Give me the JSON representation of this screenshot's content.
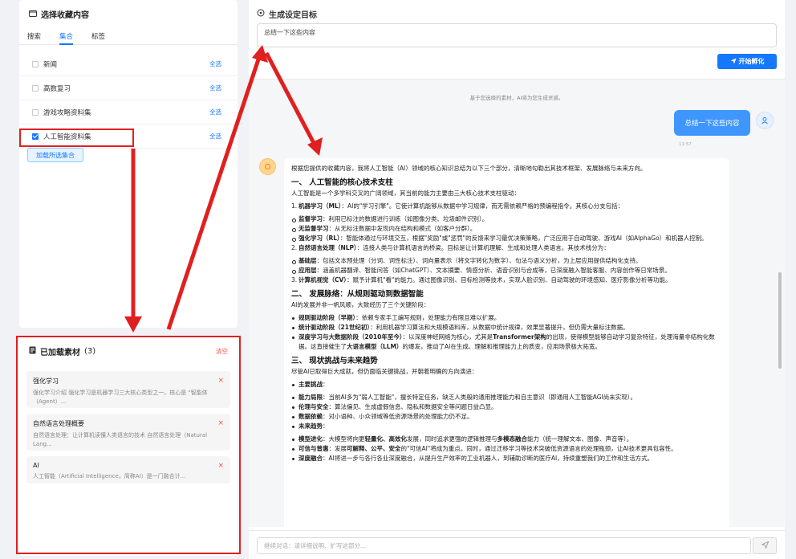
{
  "left_panel": {
    "title": "选择收藏内容",
    "tabs": [
      {
        "label": "搜索",
        "active": false
      },
      {
        "label": "集合",
        "active": true
      },
      {
        "label": "标签",
        "active": false
      }
    ],
    "collections": [
      {
        "label": "新闻",
        "checked": false,
        "select_all": "全选"
      },
      {
        "label": "高数复习",
        "checked": false,
        "select_all": "全选"
      },
      {
        "label": "游戏攻略资料集",
        "checked": false,
        "select_all": "全选"
      },
      {
        "label": "人工智能资料集",
        "checked": true,
        "select_all": "全选"
      }
    ],
    "load_button": "加载所选集合"
  },
  "loaded_panel": {
    "title": "已加载素材",
    "count": "(3)",
    "clear_label": "清空",
    "items": [
      {
        "title": "强化学习",
        "desc": "强化学习介绍 强化学习是机器学习三大核心类型之一。核心是 \"智能体（Agent）...",
        "remove": "×"
      },
      {
        "title": "自然语言处理概要",
        "desc": "自然语言处理：让计算机读懂人类语言的技术 自然语言处理（Natural Lang...",
        "remove": "×"
      },
      {
        "title": "AI",
        "desc": "人工智能（Artificial Intelligence，简称AI）是一门融合计...",
        "remove": "×"
      }
    ]
  },
  "main": {
    "title": "生成设定目标",
    "goal_value": "总结一下这些内容",
    "hatch_button": "开始孵化",
    "hint": "基于您选择的素材，AI将为您生成灵感。",
    "user_message": "总结一下这些内容",
    "user_time": "11:57",
    "ai": {
      "intro": "根据您提供的收藏内容，我将人工智能（AI）领域的核心知识总结为以下三个部分，清晰地勾勒出其技术框架、发展脉络与未来方向。",
      "h1": "一、 人工智能的核心技术支柱",
      "h1_p": "人工智能是一个多学科交叉的广阔领域，其当前的能力主要由三大核心技术支柱驱动：",
      "ml_num": "1.",
      "ml_bold": "机器学习（ML）",
      "ml_text": "：AI的\"学习引擎\"。它使计算机能够从数据中学习规律，而无需依赖严格的预编程指令。其核心分支包括：",
      "ml_items": [
        {
          "bold": "监督学习",
          "text": "：利用已标注的数据进行训练（如图像分类、垃圾邮件识别）。"
        },
        {
          "bold": "无监督学习",
          "text": "：从无标注数据中发现内在结构和模式（如客户分群）。"
        },
        {
          "bold": "强化学习（RL）",
          "text": "：智能体通过与环境交互，根据\"奖励\"或\"惩罚\"的反馈来学习最优决策策略，广泛应用于自动驾驶、游戏AI（如AlphaGo）和机器人控制。"
        }
      ],
      "nlp_num": "2.",
      "nlp_bold": "自然语言处理（NLP）",
      "nlp_text": "：连接人类与计算机语言的桥梁。目标是让计算机理解、生成和处理人类语言。其技术栈分为：",
      "nlp_items": [
        {
          "bold": "基础层",
          "text": "：包括文本预处理（分词、词性标注）、词向量表示（将文字转化为数字）、句法与语义分析，为上层应用提供结构化支持。"
        },
        {
          "bold": "应用层",
          "text": "：涵盖机器翻译、智能问答（如ChatGPT）、文本摘要、情感分析、语音识别与合成等，已深度融入智能客服、内容创作等日常场景。"
        }
      ],
      "cv_num": "3.",
      "cv_bold": "计算机视觉（CV）",
      "cv_text": "：赋予计算机\"看\"的能力。通过图像识别、目标检测等技术，实现人脸识别、自动驾驶的环境感知、医疗影像分析等功能。",
      "h2": "二、 发展脉络：从规则驱动到数据智能",
      "h2_p": "AI的发展并非一帆风顺，大致经历了三个关键阶段：",
      "stages": [
        {
          "bold": "规则驱动阶段（早期）",
          "text": "：依赖专家手工编写规则，处理能力有限且难以扩展。"
        },
        {
          "bold": "统计驱动阶段（21世纪初）",
          "text": "：利用机器学习算法和大规模语料库，从数据中统计规律，效果显著提升，但仍需大量标注数据。"
        },
        {
          "bold": "深度学习与大数据阶段（2010年至今）",
          "text_a": "：以深度神经网络为核心，尤其是",
          "bold_b": "Transformer架构",
          "text_b": "的出现，使得模型能够自动学习复杂特征，处理海量非结构化数据。这直接催生了",
          "bold_c": "大语言模型（LLM）",
          "text_c": "的爆发，推动了AI在生成、理解和推理能力上的质变，应用场景极大拓宽。"
        }
      ],
      "h3": "三、 现状挑战与未来趋势",
      "h3_p": "尽管AI已取得巨大成就，但仍面临关键挑战，并朝着明确的方向演进：",
      "challenges_label": "主要挑战",
      "challenges_colon": "：",
      "challenges": [
        {
          "bold": "能力局限",
          "text": "：当前AI多为\"弱人工智能\"，擅长特定任务，缺乏人类般的通用推理能力和自主意识（即通用人工智能AGI尚未实现）。"
        },
        {
          "bold": "伦理与安全",
          "text": "：算法偏见、生成虚假信息、隐私和数据安全等问题日益凸显。"
        },
        {
          "bold": "数据依赖",
          "text": "：对小语种、小众领域等低资源场景的处理能力仍不足。"
        }
      ],
      "trends_label": "未来趋势",
      "trends_colon": "：",
      "trends": [
        {
          "bold": "模型进化",
          "text_a": "：大模型将向更",
          "bold_b": "轻量化、高效化",
          "text_b": "发展，同时追求更强的逻辑推理与",
          "bold_c": "多模态融合",
          "text_c": "能力（统一理解文本、图像、声音等）。"
        },
        {
          "bold": "可信与普惠",
          "text_a": "：发展",
          "bold_b": "可解释、公平、安全",
          "text_b": "的\"可信AI\"将成为重点。同时，通过迁移学习等技术突破低资源语言的处理瓶颈，让AI技术更具包容性。"
        },
        {
          "bold": "深度融合",
          "text": "：AI将进一步与各行各业深度融合，从提升生产效率的工业机器人，到辅助诊断的医疗AI，持续重塑我们的工作和生活方式。"
        }
      ]
    },
    "chat_placeholder": "继续对话：请详细说明、扩写这部分..."
  },
  "icons": {
    "collection": "folder-icon",
    "target": "target-icon",
    "send": "send-icon",
    "user": "user-icon",
    "ai": "ai-icon"
  },
  "colors": {
    "accent": "#1677ff",
    "danger": "#ff4d4f",
    "annotation": "#e02020"
  }
}
